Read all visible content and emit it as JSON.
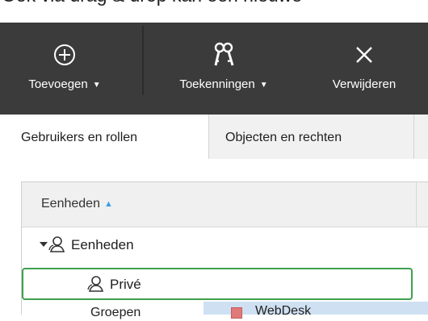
{
  "header": {
    "partial_text": "Ook via drag & drop kan een nieuwe"
  },
  "toolbar": {
    "add": {
      "label": "Toevoegen",
      "icon": "plus-circle-icon"
    },
    "grant": {
      "label": "Toekenningen",
      "icon": "keys-icon"
    },
    "delete": {
      "label": "Verwijderen",
      "icon": "close-icon"
    },
    "caret": "▼"
  },
  "tabs": [
    {
      "label": "Gebruikers en rollen",
      "active": true
    },
    {
      "label": "Objecten en rechten",
      "active": false
    }
  ],
  "tree": {
    "column_header": "Eenheden",
    "sort_indicator": "▲",
    "rows": [
      {
        "label": "Eenheden",
        "expanded": true,
        "icon": "unit-user-icon"
      },
      {
        "label": "Privé",
        "selected": true,
        "icon": "unit-user-icon"
      }
    ],
    "partial_row_text": "Groepen",
    "drag_item_text": "WebDesk"
  },
  "colors": {
    "toolbar_bg": "#3b3b3b",
    "selection_border": "#3fa04c",
    "sort_arrow": "#3ba1e3",
    "drag_highlight": "#cfe0f2"
  }
}
